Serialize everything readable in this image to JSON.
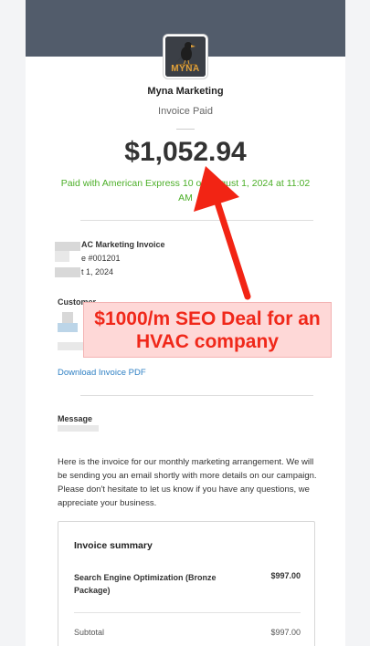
{
  "merchant": {
    "logo_text": "MYNA",
    "name": "Myna Marketing",
    "status": "Invoice Paid"
  },
  "payment": {
    "amount": "$1,052.94",
    "paid_line": "Paid with American Express 10   on August 1, 2024 at 11:02 AM"
  },
  "invoice": {
    "title_fragment": "AC Marketing Invoice",
    "number_fragment": "e #001201",
    "date_fragment": "t 1, 2024"
  },
  "customer": {
    "label": "Customer"
  },
  "download_link": "Download Invoice PDF",
  "message": {
    "label": "Message",
    "body": "Here is the invoice for our monthly marketing arrangement. We will be sending you an email shortly with more details on our campaign. Please don't hesitate to let us know if you have any questions, we appreciate your business."
  },
  "summary": {
    "title": "Invoice summary",
    "item_name": "Search Engine Optimization (Bronze Package)",
    "item_price": "$997.00",
    "subtotal_label": "Subtotal",
    "subtotal_value": "$997.00"
  },
  "annotation": {
    "text": "$1000/m SEO Deal for an HVAC company",
    "color": "#f0281a"
  },
  "colors": {
    "header_band": "#525c6b",
    "paid_green": "#4caf28",
    "link_blue": "#2f80c4"
  }
}
